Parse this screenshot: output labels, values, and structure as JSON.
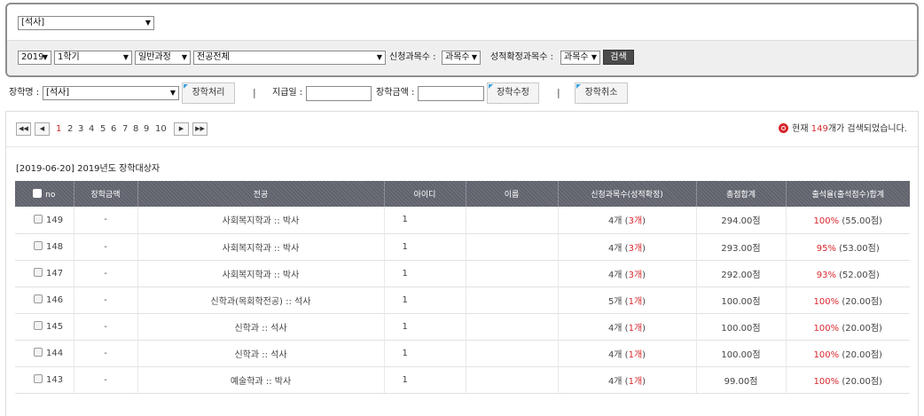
{
  "search": {
    "degree_top": "[석사]",
    "year": "2019",
    "semester": "1학기",
    "course_type": "일반과정",
    "major": "전공전체",
    "apply_label": "신청과목수 :",
    "apply_value": "과목수",
    "confirm_label": "성적확정과목수 :",
    "confirm_value": "과목수",
    "search_btn": "검색"
  },
  "actions": {
    "scholarship_label": "장학명 :",
    "scholarship_value": "[석사]",
    "process_btn": "장학처리",
    "pay_date_label": "지급일 :",
    "amount_label": "장학금액 :",
    "edit_btn": "장학수정",
    "cancel_btn": "장학취소",
    "sep": "|"
  },
  "pager": {
    "first": "◀◀",
    "prev": "◀",
    "next": "▶",
    "last": "▶▶",
    "pages": [
      "1",
      "2",
      "3",
      "4",
      "5",
      "6",
      "7",
      "8",
      "9",
      "10"
    ],
    "current": "1",
    "result_prefix": "현재 ",
    "result_count": "149",
    "result_suffix": "개가 검색되었습니다."
  },
  "caption": "[2019-06-20] 2019년도 장학대상자",
  "table": {
    "headers": [
      "no",
      "장학금액",
      "전공",
      "아이디",
      "이름",
      "신청과목수(성적확정)",
      "총점합계",
      "출석율(출석점수)합계"
    ],
    "rows": [
      {
        "no": "149",
        "amount": "-",
        "major": "사회복지학과 :: 박사",
        "id": "1",
        "name": "",
        "apply": "4개 (",
        "confirm": "3개",
        "close": ")",
        "total": "294.00점",
        "att": "100%",
        "att_score": " (55.00점)"
      },
      {
        "no": "148",
        "amount": "-",
        "major": "사회복지학과 :: 박사",
        "id": "1",
        "name": "",
        "apply": "4개 (",
        "confirm": "3개",
        "close": ")",
        "total": "293.00점",
        "att": "95%",
        "att_score": " (53.00점)"
      },
      {
        "no": "147",
        "amount": "-",
        "major": "사회복지학과 :: 박사",
        "id": "1",
        "name": "",
        "apply": "4개 (",
        "confirm": "3개",
        "close": ")",
        "total": "292.00점",
        "att": "93%",
        "att_score": " (52.00점)"
      },
      {
        "no": "146",
        "amount": "-",
        "major": "신학과(목회학전공) :: 석사",
        "id": "1",
        "name": "",
        "apply": "5개 (",
        "confirm": "1개",
        "close": ")",
        "total": "100.00점",
        "att": "100%",
        "att_score": " (20.00점)"
      },
      {
        "no": "145",
        "amount": "-",
        "major": "신학과 :: 석사",
        "id": "1",
        "name": "",
        "apply": "4개 (",
        "confirm": "1개",
        "close": ")",
        "total": "100.00점",
        "att": "100%",
        "att_score": " (20.00점)"
      },
      {
        "no": "144",
        "amount": "-",
        "major": "신학과 :: 석사",
        "id": "1",
        "name": "",
        "apply": "4개 (",
        "confirm": "1개",
        "close": ")",
        "total": "100.00점",
        "att": "100%",
        "att_score": " (20.00점)"
      },
      {
        "no": "143",
        "amount": "-",
        "major": "예술학과 :: 박사",
        "id": "1",
        "name": "",
        "apply": "4개 (",
        "confirm": "1개",
        "close": ")",
        "total": "99.00점",
        "att": "100%",
        "att_score": " (20.00점)"
      }
    ]
  },
  "colors": {
    "accent_red": "#d8272d",
    "header_bg": "#5b5e67"
  },
  "icons": {
    "result": "magnifier-icon",
    "dropdown": "chevron-down-icon"
  }
}
